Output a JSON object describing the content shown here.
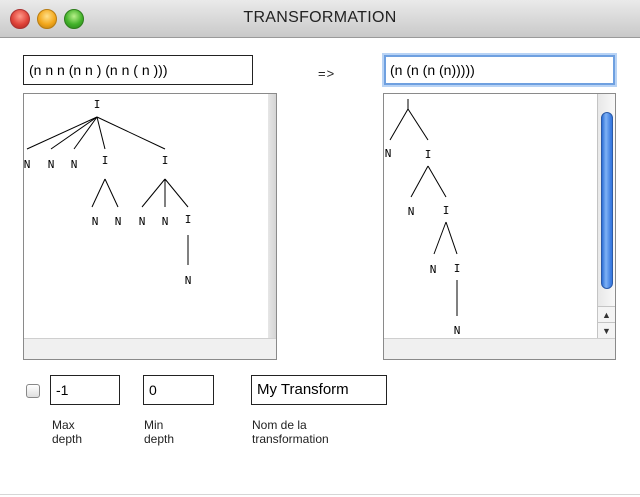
{
  "window": {
    "title": "TRANSFORMATION"
  },
  "source": {
    "expression": "(n n n (n n ) (n n ( n )))"
  },
  "arrow": "=>",
  "target": {
    "expression": "(n (n (n (n)))))"
  },
  "tree_glyphs": {
    "branch": "I",
    "leaf": "N"
  },
  "scroll": {
    "up": "▲",
    "down": "▼"
  },
  "controls": {
    "max_depth_value": "-1",
    "min_depth_value": "0",
    "name_value": "My Transform",
    "max_depth_label": "Max\ndepth",
    "min_depth_label": "Min\ndepth",
    "name_label": "Nom de la\ntransformation"
  }
}
